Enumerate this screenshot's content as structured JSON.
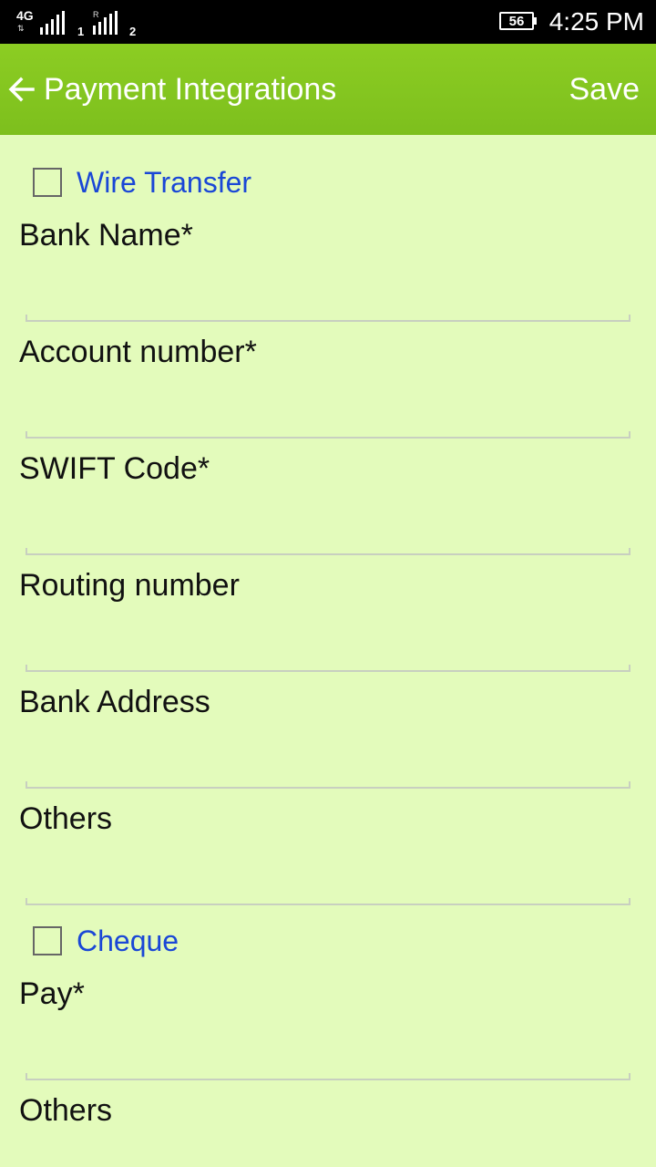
{
  "status_bar": {
    "net1": "4G",
    "sim1": "1",
    "roaming": "R",
    "sim2": "2",
    "battery": "56",
    "time": "4:25 PM"
  },
  "app_bar": {
    "back_icon": "arrow-left-icon",
    "title": "Payment Integrations",
    "save_label": "Save"
  },
  "colors": {
    "app_bar": "#8ccd23",
    "background": "#e3fbbb",
    "checkbox_label": "#1a47d6"
  },
  "form": {
    "wire_transfer": {
      "label": "Wire Transfer",
      "checked": false,
      "fields": [
        {
          "label": "Bank Name*",
          "value": ""
        },
        {
          "label": "Account number*",
          "value": ""
        },
        {
          "label": "SWIFT Code*",
          "value": ""
        },
        {
          "label": "Routing number",
          "value": ""
        },
        {
          "label": "Bank Address",
          "value": ""
        },
        {
          "label": "Others",
          "value": ""
        }
      ]
    },
    "cheque": {
      "label": "Cheque",
      "checked": false,
      "fields": [
        {
          "label": "Pay*",
          "value": ""
        },
        {
          "label": "Others",
          "value": ""
        }
      ]
    }
  }
}
